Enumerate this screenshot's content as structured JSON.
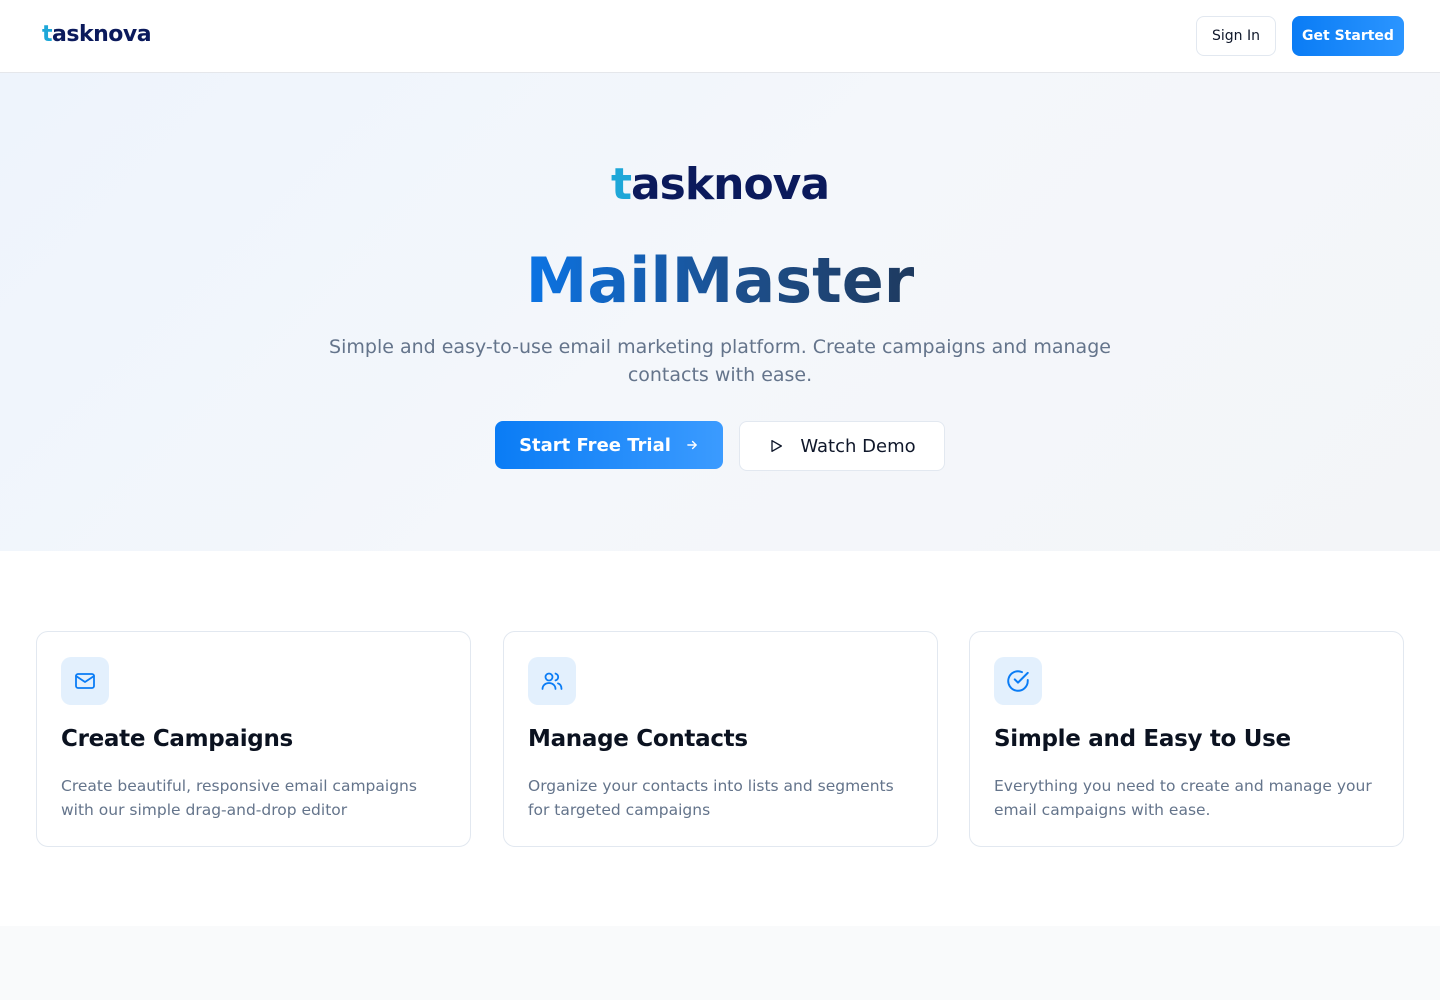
{
  "header": {
    "logo_first": "t",
    "logo_rest": "asknova",
    "signin_label": "Sign In",
    "getstarted_label": "Get Started"
  },
  "hero": {
    "logo_first": "t",
    "logo_rest": "asknova",
    "title": "MailMaster",
    "subtitle": "Simple and easy-to-use email marketing platform. Create campaigns and manage contacts with ease.",
    "trial_label": "Start Free Trial",
    "demo_label": "Watch Demo"
  },
  "features": [
    {
      "icon": "mail-icon",
      "title": "Create Campaigns",
      "description": "Create beautiful, responsive email campaigns with our simple drag-and-drop editor"
    },
    {
      "icon": "users-icon",
      "title": "Manage Contacts",
      "description": "Organize your contacts into lists and segments for targeted campaigns"
    },
    {
      "icon": "check-circle-icon",
      "title": "Simple and Easy to Use",
      "description": "Everything you need to create and manage your email campaigns with ease."
    }
  ],
  "colors": {
    "brand_blue": "#0a7cf5",
    "logo_navy": "#0b1a5c",
    "logo_accent": "#1ea7d8",
    "muted_text": "#64748b",
    "icon_bg": "#e3f0fd"
  }
}
